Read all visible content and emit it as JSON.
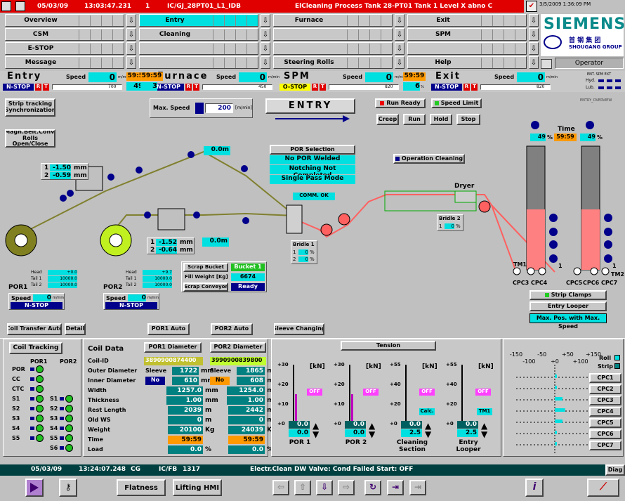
{
  "titlebar": {
    "date": "05/03/09",
    "time": "13:03:47.231",
    "num": "1",
    "plant": "IC/GJ_28PT01_L1_IDB",
    "title": "ElCleaning Process Tank 28-PT01 Tank 1 Level X abno C",
    "datetime": "3/5/2009 1:36:09 PM"
  },
  "nav": {
    "r1": [
      "Overview",
      "Entry",
      "Furnace",
      "Exit"
    ],
    "r2": [
      "CSM",
      "Cleaning",
      "",
      "SPM"
    ],
    "r3": [
      "E-STOP",
      "",
      "",
      ""
    ],
    "r4": [
      "Message",
      "",
      "Steering Rolls",
      "Help"
    ]
  },
  "brand": {
    "siemens": "SIEMENS",
    "cn": "首 钢 集 团",
    "en": "SHOUGANG GROUP",
    "operator": "Operator"
  },
  "sections": [
    {
      "name": "Entry",
      "speed_label": "Speed",
      "speed": "0",
      "unit": "m/min",
      "timer": "59:59",
      "pct": "49",
      "pct_unit": "%",
      "state": "N-STOP",
      "scale": "700",
      "r": "R",
      "t": "T"
    },
    {
      "name": "Furnace",
      "speed_label": "Speed",
      "speed": "0",
      "unit": "m/min",
      "timer": "59:59",
      "pct": "3",
      "pct_unit": "%",
      "state": "N-STOP",
      "scale": "450",
      "r": "R",
      "t": "T"
    },
    {
      "name": "SPM",
      "speed_label": "Speed",
      "speed": "0",
      "unit": "m/min",
      "timer": "59:59",
      "pct": "6",
      "pct_unit": "%",
      "state": "O-STOP",
      "scale": "820",
      "r": "R",
      "t": "T"
    },
    {
      "name": "Exit",
      "speed_label": "Speed",
      "speed": "0",
      "unit": "m/min",
      "timer": "",
      "pct": "",
      "pct_unit": "",
      "state": "N-STOP",
      "scale": "820",
      "r": "R",
      "t": "T"
    }
  ],
  "exit_extra": {
    "top": "ENT. SPM EXT",
    "hyd": "Hyd.",
    "lub": "Lub."
  },
  "controls": {
    "strip_tracking": "Strip tracking Synchronization",
    "max_speed_label": "Max. Speed",
    "max_speed": "200",
    "max_speed_unit": "[m/min]",
    "title": "ENTRY",
    "run_ready": "Run Ready",
    "speed_limit": "Speed Limit",
    "creep": "Creep",
    "run": "Run",
    "hold": "Hold",
    "stop": "Stop",
    "overview_tag": "ENTRY_OVERVIEW",
    "magn": "Magn.Belt.Conv. Rolls Open/Close"
  },
  "por_sel": {
    "title": "POR Selection",
    "l1": "No POR Welded",
    "l2": "Notching Not Completed",
    "l3": "Single Pass Mode",
    "comm": "COMM. OK"
  },
  "diagram": {
    "len1": "0.0m",
    "len2": "0.0m",
    "m1a": "1",
    "m1b": "-1.50",
    "m1u": "mm",
    "m2a": "2",
    "m2b": "-0.59",
    "m2u": "mm",
    "m3a": "1",
    "m3b": "-1.52",
    "m3u": "mm",
    "m4a": "2",
    "m4b": "-0.64",
    "m4u": "mm",
    "op_clean": "Operation Cleaning",
    "dryer": "Dryer",
    "bridle1": "Bridle 1",
    "bridle2": "Bridle 2",
    "b1r1": "1",
    "b1v1": "0",
    "b1r2": "2",
    "b1v2": "0",
    "b2r": "1",
    "b2v": "0",
    "pct": "%",
    "time": "Time",
    "time_val": "59:59",
    "loop_l": "49",
    "loop_r": "49",
    "loop_pct": "%",
    "tm1": "TM1",
    "tm2": "TM2",
    "one": "1",
    "cpc3": "CPC3",
    "cpc4": "CPC4",
    "cpc5": "CPC5",
    "cpc6": "CPC6",
    "cpc7": "CPC7",
    "strip_clamps": "Strip Clamps",
    "entry_looper": "Entry Looper",
    "maxpos": "Max. Pos. with Max. Speed"
  },
  "scrap": {
    "bucket_lbl": "Scrap Bucket",
    "bucket": "Bucket 1",
    "fill_lbl": "Fill Weight [Kg]",
    "fill": "6674",
    "conv_lbl": "Scrap Conveyor",
    "conv": "Ready"
  },
  "por1": {
    "name": "POR1",
    "head_lbl": "Head",
    "head": "+0.0",
    "t1_lbl": "Tail 1",
    "t1": "10000.0",
    "t2_lbl": "Tail 2",
    "t2": "10000.0",
    "speed_lbl": "Speed",
    "speed": "0",
    "unit": "m/min",
    "state": "N-STOP"
  },
  "por2": {
    "name": "POR2",
    "head_lbl": "Head",
    "head": "+9.7",
    "t1_lbl": "Tail 1",
    "t1": "10000.0",
    "t2_lbl": "Tail 2",
    "t2": "10000.0",
    "speed_lbl": "Speed",
    "speed": "0",
    "unit": "m/min",
    "state": "N-STOP"
  },
  "mid_btns": {
    "coil_transfer": "Coil Transfer Auto",
    "detail": "Detail",
    "por1auto": "POR1 Auto",
    "por2auto": "POR2 Auto",
    "sleeve": "Sleeve Changing"
  },
  "tracking": {
    "title": "Coil Tracking",
    "h1": "POR1",
    "h2": "POR2",
    "rows1": [
      "POR",
      "CC",
      "CTC",
      "S1",
      "S2",
      "S3",
      "S4",
      "S5"
    ],
    "rows2": [
      "S1",
      "S2",
      "S3",
      "S4",
      "S5",
      "S6"
    ]
  },
  "coil": {
    "title": "Coil Data",
    "por1d": "POR1 Diameter",
    "por2d": "POR2 Diameter",
    "labels": [
      "Coil-ID",
      "Outer Diameter",
      "Inner Diameter",
      "Width",
      "Thickness",
      "Rest Length",
      "Old WS",
      "Weight",
      "Time",
      "Load"
    ],
    "id1": "3890900874400",
    "id2": "3990900839800",
    "sleeve": "Sleeve",
    "no": "No",
    "od1": "1722",
    "od2": "1865",
    "id_1": "610",
    "id_2": "608",
    "w1": "1257.0",
    "w2": "1254.0",
    "t1": "1.00",
    "t2": "1.00",
    "rl1": "2039",
    "rl2": "2442",
    "ows1": "0",
    "ows2": "0",
    "wt1": "20100",
    "wt2": "24039",
    "tm1": "59:59",
    "tm2": "59:59",
    "ld1": "0.0",
    "ld2": "0.0",
    "mm": "mm",
    "m": "m",
    "kg": "Kg",
    "pct": "%"
  },
  "tension": {
    "title": "Tension",
    "unit": "[kN]",
    "off": "OFF",
    "calc": "Calc.",
    "tm1": "TM1",
    "g": [
      {
        "top": "+30",
        "mid": "+20",
        "low": "+10",
        "zero": "+0",
        "val": "0.0",
        "val2": "0.0",
        "name": "POR 1"
      },
      {
        "top": "+30",
        "mid": "+20",
        "low": "+10",
        "zero": "+0",
        "val": "0.0",
        "val2": "0.0",
        "name": "POR 2"
      },
      {
        "top": "+55",
        "mid": "+40",
        "low": "+20",
        "zero": "+0",
        "val": "0.0",
        "val2": "2.5",
        "name": "Cleaning Section"
      },
      {
        "top": "+55",
        "mid": "+40",
        "low": "+20",
        "zero": "+0",
        "val": "0.0",
        "val2": "2.5",
        "name": "Entry Looper"
      }
    ]
  },
  "cpc": {
    "ticks": [
      "-150",
      "-50",
      "+50",
      "+150"
    ],
    "ticks2": [
      "-100",
      "+0",
      "+100"
    ],
    "roll": "Roll",
    "strip": "Strip",
    "btns": [
      "CPC1",
      "CPC2",
      "CPC3",
      "CPC4",
      "CPC5",
      "CPC6",
      "CPC7"
    ],
    "chart_data": {
      "type": "bar",
      "categories": [
        "CPC1",
        "CPC2",
        "CPC3",
        "CPC4",
        "CPC5",
        "CPC6",
        "CPC7"
      ],
      "series": [
        {
          "values": [
            0,
            0,
            30,
            40,
            30,
            0,
            0
          ]
        }
      ]
    }
  },
  "status": {
    "date": "05/03/09",
    "time": "13:24:07.248",
    "cg": "CG",
    "code": "IC/FB",
    "num": "1317",
    "msg": "Electr.Clean DW Valve: Cond Failed Start: OFF",
    "diag": "Diag"
  },
  "bottom": {
    "flatness": "Flatness",
    "lifting": "Lifting HMI"
  }
}
